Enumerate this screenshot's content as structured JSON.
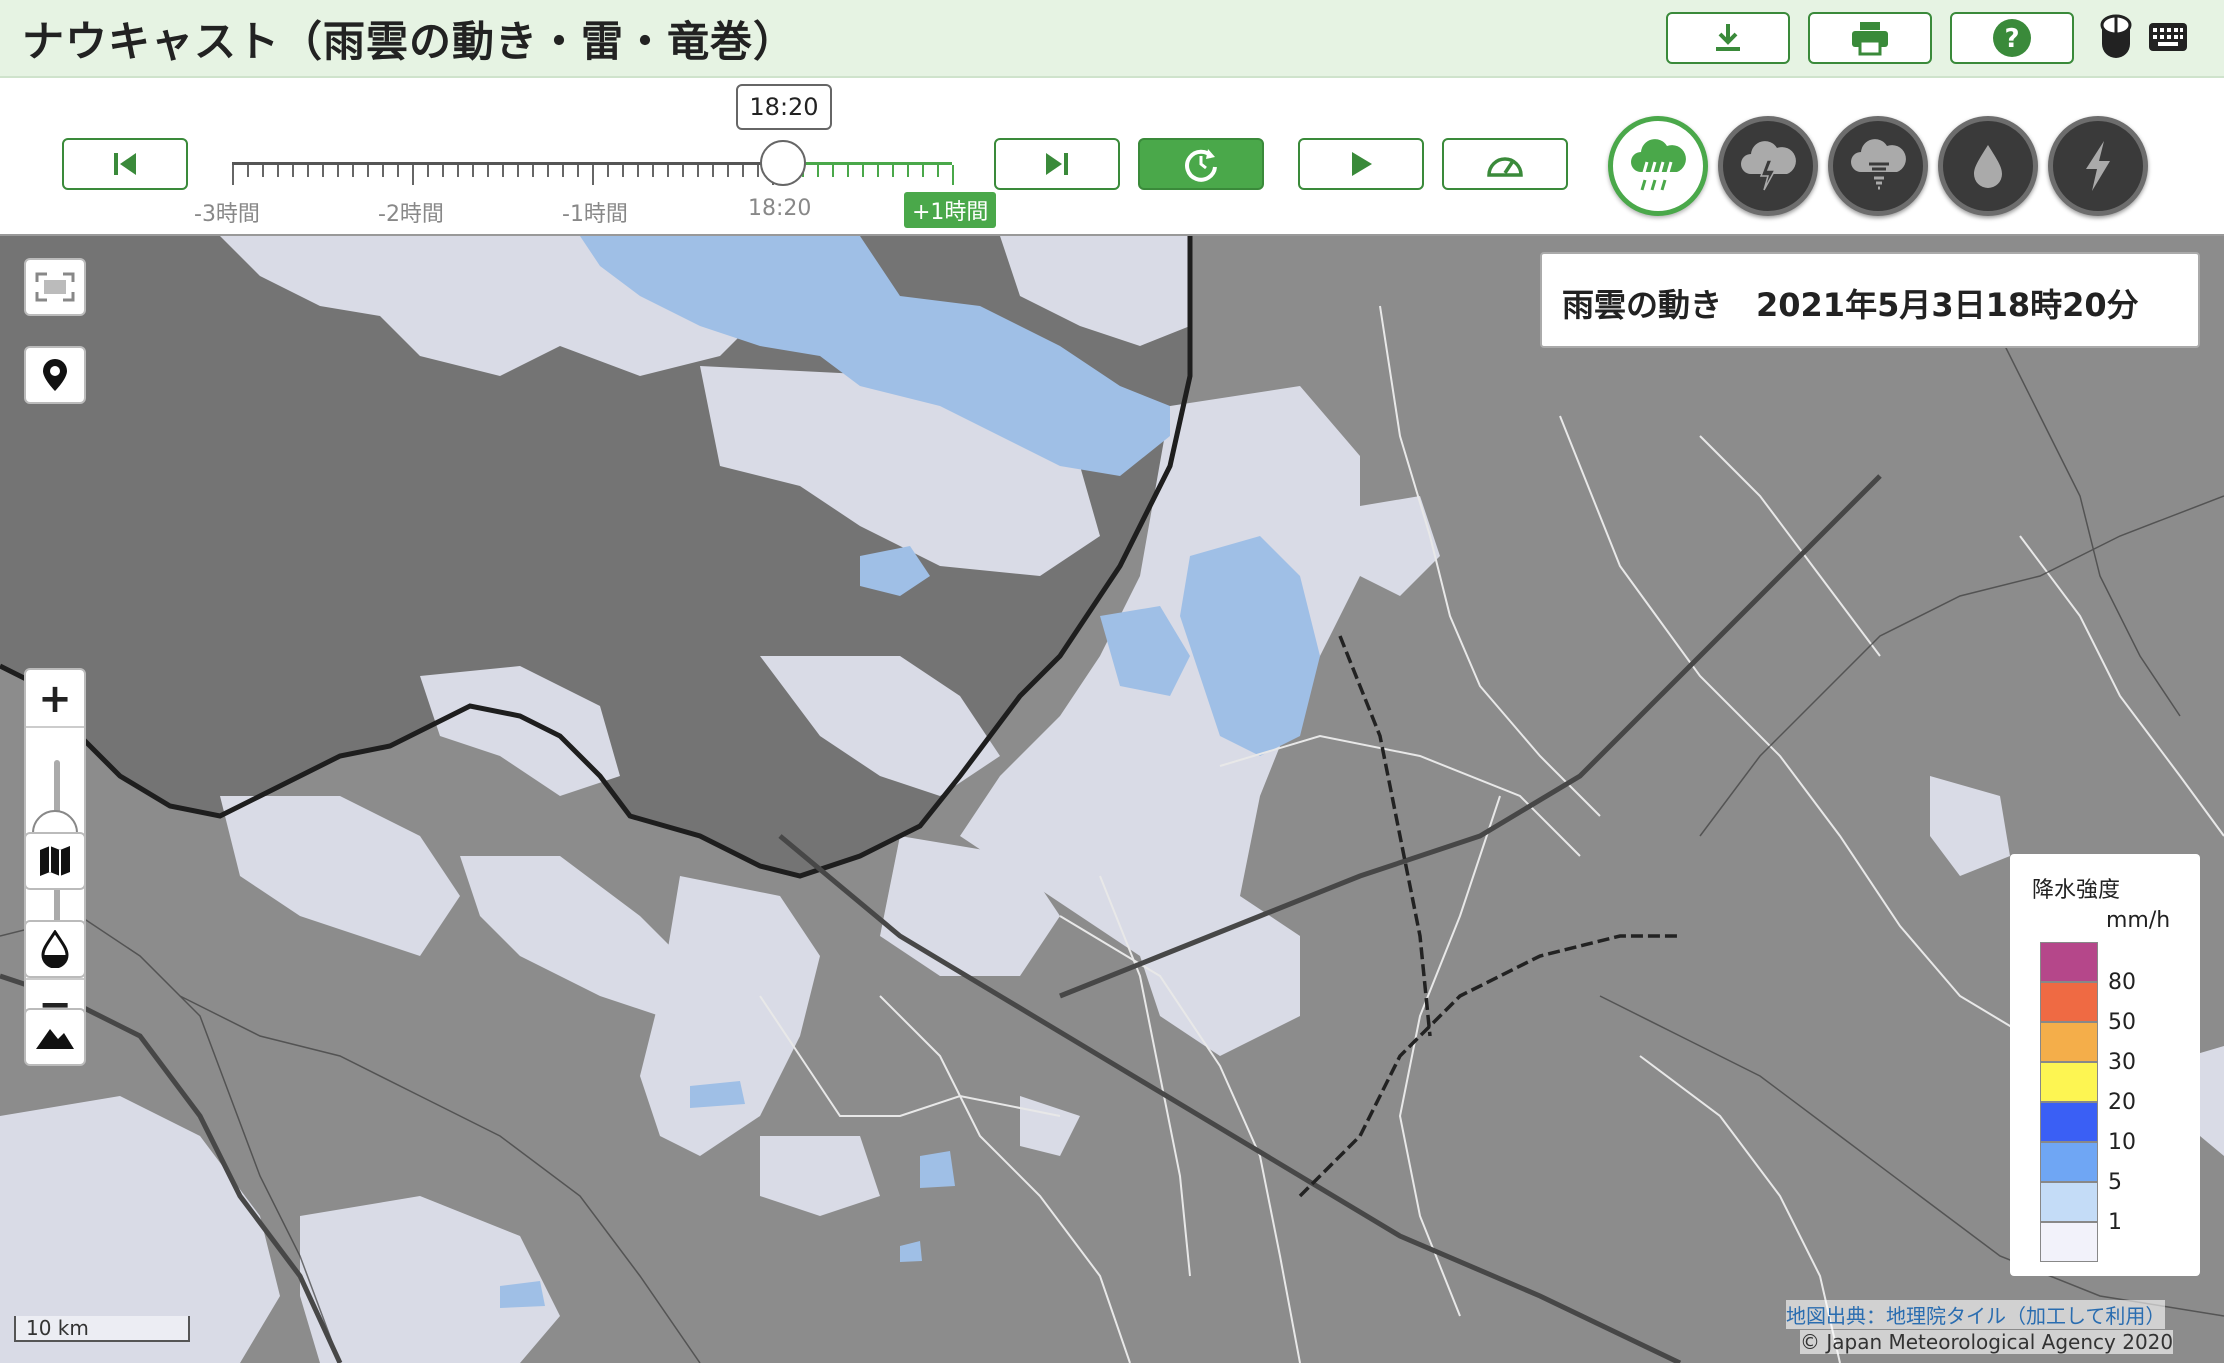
{
  "app": {
    "title": "ナウキャスト（雨雲の動き・雷・竜巻）"
  },
  "toolbar": {
    "download_icon": "download-icon",
    "print_icon": "print-icon",
    "help_icon": "help-icon",
    "mouse_icon": "mouse-icon",
    "keyboard_icon": "keyboard-icon"
  },
  "timeline": {
    "current_time": "18:20",
    "ticks": [
      "-3時間",
      "-2時間",
      "-1時間",
      "18:20",
      "+1時間"
    ],
    "position_fraction": 0.77
  },
  "playback": {
    "first_icon": "skip-first-icon",
    "last_icon": "skip-last-icon",
    "latest_icon": "refresh-latest-icon",
    "play_icon": "play-icon",
    "speed_icon": "speed-icon"
  },
  "modes": [
    {
      "name": "raincloud",
      "icon": "rain-cloud-icon",
      "active": true
    },
    {
      "name": "thunder",
      "icon": "thunder-cloud-icon",
      "active": false
    },
    {
      "name": "tornado",
      "icon": "tornado-cloud-icon",
      "active": false
    },
    {
      "name": "rain",
      "icon": "rain-drop-icon",
      "active": false
    },
    {
      "name": "lightning",
      "icon": "lightning-icon",
      "active": false
    }
  ],
  "map": {
    "info_layer": "雨雲の動き",
    "info_time": "2021年5月3日18時20分",
    "zoom": {
      "plus": "+",
      "minus": "−",
      "level_fraction": 0.45
    },
    "scale": "10 km",
    "attribution_map": "地図出典：地理院タイル（加工して利用）",
    "attribution_jma": "© Japan Meteorological Agency 2020"
  },
  "legend": {
    "title": "降水強度",
    "unit": "mm/h",
    "levels": [
      {
        "label": "",
        "color": "#b5478a"
      },
      {
        "label": "80",
        "color": "#ef6a43"
      },
      {
        "label": "50",
        "color": "#f4ae4a"
      },
      {
        "label": "30",
        "color": "#fdf552"
      },
      {
        "label": "20",
        "color": "#3a5ff5"
      },
      {
        "label": "10",
        "color": "#6fa6f4"
      },
      {
        "label": "5",
        "color": "#c4dcf7"
      },
      {
        "label": "1",
        "color": "#f2f2fa"
      }
    ]
  },
  "colors": {
    "accent": "#4aa84a",
    "header_bg": "#e6f3e3",
    "land": "#8c8c8c",
    "sea": "#747474",
    "cloud_light": "#d9dbe6",
    "cloud_blue": "#9fbfe6"
  }
}
